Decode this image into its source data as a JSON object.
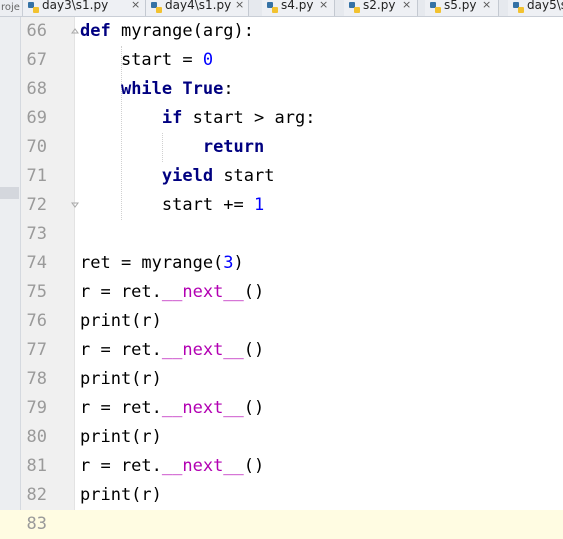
{
  "project_panel": {
    "label": "roje"
  },
  "tabs": [
    {
      "label": "day3\\s1.py",
      "close": "×"
    },
    {
      "label": "day4\\s1.py",
      "close": "×"
    },
    {
      "label": "s4.py",
      "close": "×"
    },
    {
      "label": "s2.py",
      "close": "×"
    },
    {
      "label": "s5.py",
      "close": "×"
    },
    {
      "label": "day5\\s"
    }
  ],
  "editor": {
    "current_line": 83,
    "lines": [
      {
        "num": "66",
        "parts": [
          {
            "t": "def",
            "c": "kw"
          },
          {
            "t": " myrange(arg):"
          }
        ]
      },
      {
        "num": "67",
        "parts": [
          {
            "t": "    start = "
          },
          {
            "t": "0",
            "c": "num"
          }
        ]
      },
      {
        "num": "68",
        "parts": [
          {
            "t": "    "
          },
          {
            "t": "while",
            "c": "kw"
          },
          {
            "t": " "
          },
          {
            "t": "True",
            "c": "kw"
          },
          {
            "t": ":"
          }
        ]
      },
      {
        "num": "69",
        "parts": [
          {
            "t": "        "
          },
          {
            "t": "if",
            "c": "kw"
          },
          {
            "t": " start > arg:"
          }
        ]
      },
      {
        "num": "70",
        "parts": [
          {
            "t": "            "
          },
          {
            "t": "return",
            "c": "kw"
          }
        ]
      },
      {
        "num": "71",
        "parts": [
          {
            "t": "        "
          },
          {
            "t": "yield",
            "c": "kw"
          },
          {
            "t": " start"
          }
        ]
      },
      {
        "num": "72",
        "parts": [
          {
            "t": "        start += "
          },
          {
            "t": "1",
            "c": "num"
          }
        ]
      },
      {
        "num": "73",
        "parts": []
      },
      {
        "num": "74",
        "parts": [
          {
            "t": "ret = myrange("
          },
          {
            "t": "3",
            "c": "num"
          },
          {
            "t": ")"
          }
        ]
      },
      {
        "num": "75",
        "parts": [
          {
            "t": "r = ret."
          },
          {
            "t": "__next__",
            "c": "magic"
          },
          {
            "t": "()"
          }
        ]
      },
      {
        "num": "76",
        "parts": [
          {
            "t": "print(r)"
          }
        ]
      },
      {
        "num": "77",
        "parts": [
          {
            "t": "r = ret."
          },
          {
            "t": "__next__",
            "c": "magic"
          },
          {
            "t": "()"
          }
        ]
      },
      {
        "num": "78",
        "parts": [
          {
            "t": "print(r)"
          }
        ]
      },
      {
        "num": "79",
        "parts": [
          {
            "t": "r = ret."
          },
          {
            "t": "__next__",
            "c": "magic"
          },
          {
            "t": "()"
          }
        ]
      },
      {
        "num": "80",
        "parts": [
          {
            "t": "print(r)"
          }
        ]
      },
      {
        "num": "81",
        "parts": [
          {
            "t": "r = ret."
          },
          {
            "t": "__next__",
            "c": "magic"
          },
          {
            "t": "()"
          }
        ]
      },
      {
        "num": "82",
        "parts": [
          {
            "t": "print(r)"
          }
        ]
      },
      {
        "num": "83",
        "parts": []
      }
    ]
  },
  "colors": {
    "keyword": "#000080",
    "number": "#0000ff",
    "magic_method": "#b200b2",
    "line_number": "#9a9a9a",
    "current_line_bg": "#fffce2"
  }
}
